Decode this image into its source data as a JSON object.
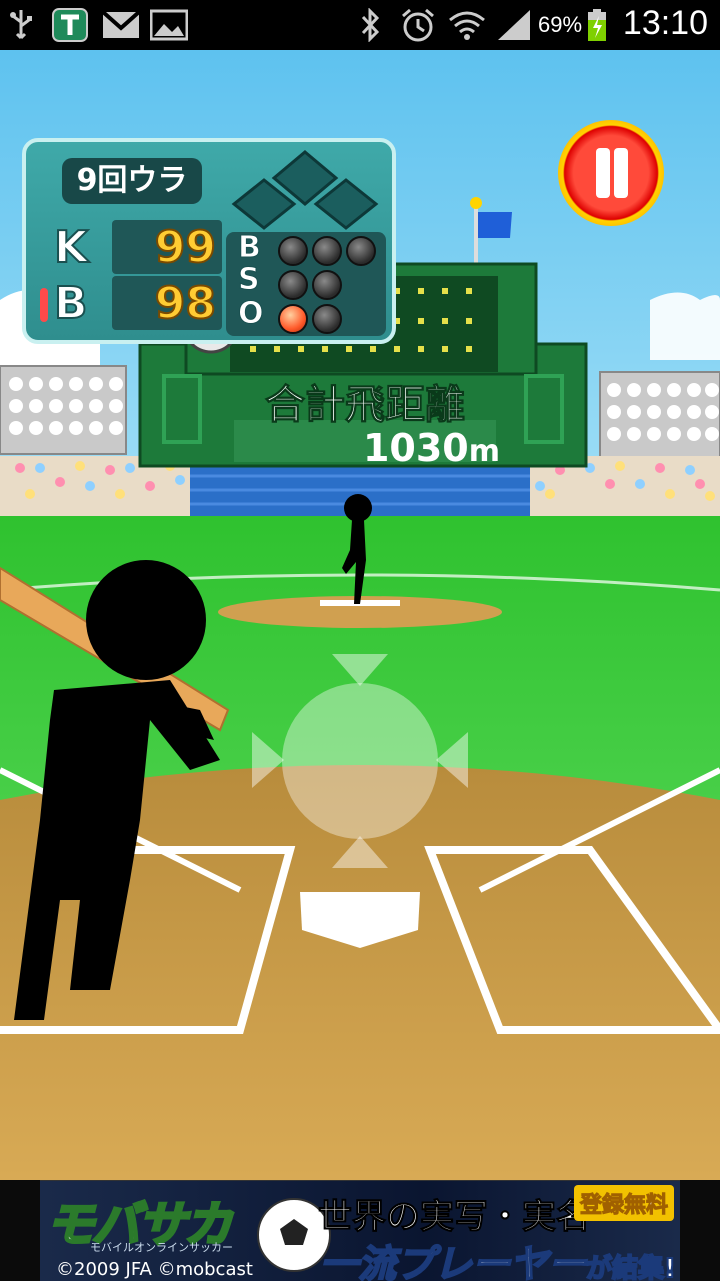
{
  "status_bar": {
    "battery_percent": "69%",
    "time": "13:10",
    "icons": [
      "usb-icon",
      "app-t-icon",
      "gmail-icon",
      "gallery-icon",
      "bluetooth-icon",
      "alarm-icon",
      "wifi-icon",
      "signal-icon",
      "battery-charging-icon"
    ]
  },
  "scoreboard": {
    "inning": "9回ウラ",
    "teams": [
      {
        "letter": "K",
        "score": "99"
      },
      {
        "letter": "B",
        "score": "98"
      }
    ],
    "count": {
      "balls": {
        "label": "B",
        "lit": 0,
        "total": 3
      },
      "strikes": {
        "label": "S",
        "lit": 0,
        "total": 2
      },
      "outs": {
        "label": "O",
        "lit": 1,
        "total": 2
      }
    }
  },
  "distance": {
    "label": "合計飛距離",
    "value": "1030",
    "unit": "m"
  },
  "ad": {
    "logo": "モバサカ",
    "subtitle": "モバイルオンラインサッカー",
    "copyright": "©2009 JFA ©mobcast",
    "headline1": "世界の実写・実名",
    "headline2": "一流プレーヤー",
    "headline2_suffix": "が結集!",
    "badge": "登録無料"
  },
  "colors": {
    "sky": "#5fc3f0",
    "field_grass": "#3fcf3f",
    "dirt": "#c99a45",
    "stadium_green": "#1f7a3a"
  }
}
